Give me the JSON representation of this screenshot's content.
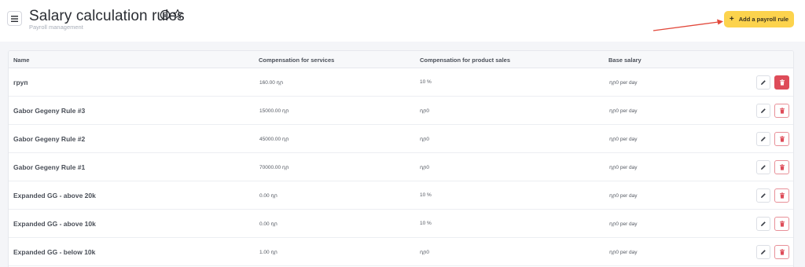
{
  "header": {
    "title": "Salary calculation rules",
    "subtitle": "Payroll management",
    "add_button_label": "Add a payroll rule"
  },
  "table": {
    "columns": [
      "Name",
      "Compensation for services",
      "Compensation for product sales",
      "Base salary"
    ],
    "rows": [
      {
        "name": "груп",
        "services": "160.00 դր",
        "products": "10 %",
        "base": "դր0 per day",
        "delete_active": true
      },
      {
        "name": "Gabor Gegeny Rule #3",
        "services": "15000.00 դր",
        "products": "դր0",
        "base": "դր0 per day",
        "delete_active": false
      },
      {
        "name": "Gabor Gegeny Rule #2",
        "services": "45000.00 դր",
        "products": "դր0",
        "base": "դր0 per day",
        "delete_active": false
      },
      {
        "name": "Gabor Gegeny Rule #1",
        "services": "70000.00 դր",
        "products": "դր0",
        "base": "դր0 per day",
        "delete_active": false
      },
      {
        "name": "Expanded GG - above 20k",
        "services": "0.00 դր",
        "products": "10 %",
        "base": "դր0 per day",
        "delete_active": false
      },
      {
        "name": "Expanded GG - above 10k",
        "services": "0.00 դր",
        "products": "10 %",
        "base": "դր0 per day",
        "delete_active": false
      },
      {
        "name": "Expanded GG - below 10k",
        "services": "1.00 դր",
        "products": "դր0",
        "base": "դր0 per day",
        "delete_active": false
      }
    ]
  },
  "icons": {
    "menu": "hamburger-menu-icon",
    "info": "info-icon",
    "favorite": "star-icon",
    "add": "plus-icon",
    "edit": "pencil-icon",
    "delete": "trash-icon"
  },
  "colors": {
    "accent": "#fcd34d",
    "danger": "#de4c59",
    "annotation_arrow": "#e2483b"
  }
}
